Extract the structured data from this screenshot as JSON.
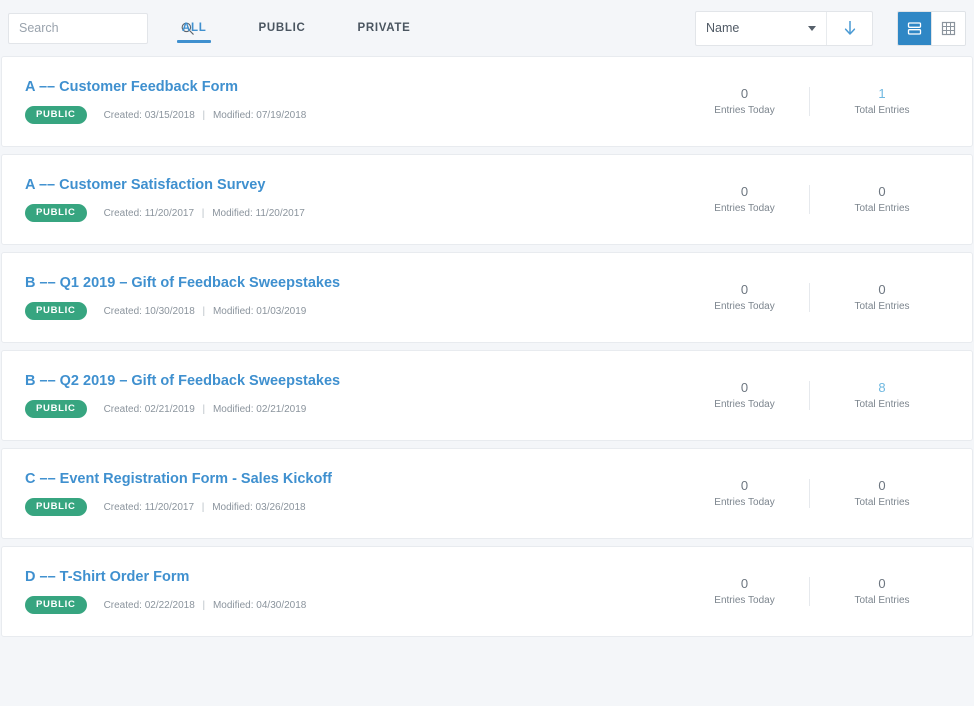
{
  "toolbar": {
    "search": {
      "placeholder": "Search",
      "value": "",
      "icon": "search-icon"
    },
    "tabs": [
      {
        "label": "ALL",
        "active": true
      },
      {
        "label": "PUBLIC",
        "active": false
      },
      {
        "label": "PRIVATE",
        "active": false
      }
    ],
    "sort": {
      "value": "Name",
      "direction_icon": "arrow-down-icon"
    },
    "views": [
      {
        "name": "list-view",
        "active": true
      },
      {
        "name": "grid-view",
        "active": false
      }
    ]
  },
  "colors": {
    "accent_blue": "#3f90cf",
    "active_view_blue": "#2f87c5",
    "link_blue": "#6fb8e0",
    "badge_green": "#37a580",
    "page_background": "#f4f6f9"
  },
  "labels": {
    "created_prefix": "Created:",
    "modified_prefix": "Modified:",
    "separator": "|",
    "entries_today": "Entries Today",
    "total_entries": "Total Entries"
  },
  "forms": [
    {
      "title": "A –– Customer Feedback Form",
      "visibility": "PUBLIC",
      "created": "03/15/2018",
      "modified": "07/19/2018",
      "entries_today": "0",
      "total_entries": "1",
      "total_entries_linked": true
    },
    {
      "title": "A –– Customer Satisfaction Survey",
      "visibility": "PUBLIC",
      "created": "11/20/2017",
      "modified": "11/20/2017",
      "entries_today": "0",
      "total_entries": "0",
      "total_entries_linked": false
    },
    {
      "title": "B –– Q1 2019 – Gift of Feedback Sweepstakes",
      "visibility": "PUBLIC",
      "created": "10/30/2018",
      "modified": "01/03/2019",
      "entries_today": "0",
      "total_entries": "0",
      "total_entries_linked": false
    },
    {
      "title": "B –– Q2 2019 – Gift of Feedback Sweepstakes",
      "visibility": "PUBLIC",
      "created": "02/21/2019",
      "modified": "02/21/2019",
      "entries_today": "0",
      "total_entries": "8",
      "total_entries_linked": true
    },
    {
      "title": "C –– Event Registration Form - Sales Kickoff",
      "visibility": "PUBLIC",
      "created": "11/20/2017",
      "modified": "03/26/2018",
      "entries_today": "0",
      "total_entries": "0",
      "total_entries_linked": false
    },
    {
      "title": "D –– T-Shirt Order Form",
      "visibility": "PUBLIC",
      "created": "02/22/2018",
      "modified": "04/30/2018",
      "entries_today": "0",
      "total_entries": "0",
      "total_entries_linked": false
    }
  ]
}
